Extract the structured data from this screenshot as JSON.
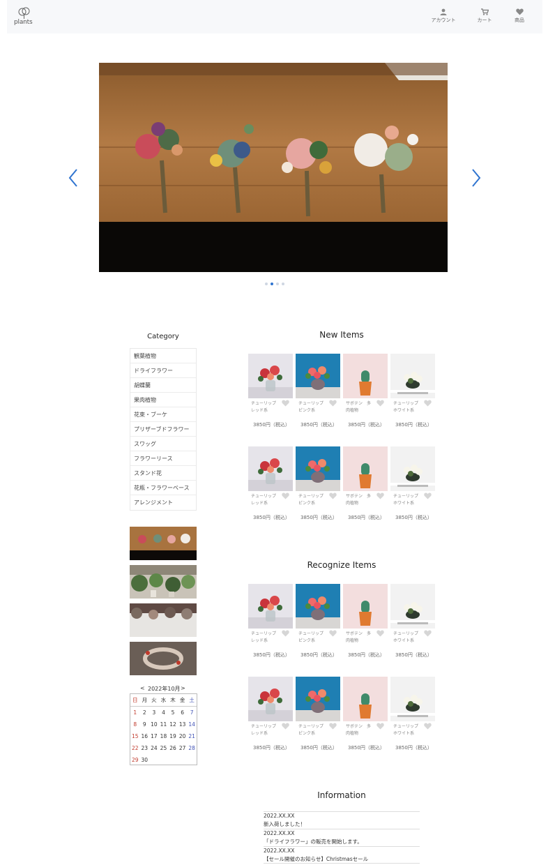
{
  "header": {
    "logo_text": "plants",
    "nav": [
      {
        "label": "アカウント",
        "icon": "user-icon"
      },
      {
        "label": "カート",
        "icon": "cart-icon"
      },
      {
        "label": "商品",
        "icon": "heart-icon"
      }
    ]
  },
  "hero": {
    "slides_count": 4,
    "active_slide": 2
  },
  "sidebar": {
    "category_title": "Category",
    "categories": [
      "観葉植物",
      "ドライフラワー",
      "胡蝶蘭",
      "果肉植物",
      "花束・ブーケ",
      "プリザーブドフラワー",
      "スワッグ",
      "フラワーリース",
      "スタンド花",
      "花瓶・フラワーベース",
      "アレンジメント"
    ],
    "banners": [
      "flower-bouquets-banner",
      "potted-plants-banner",
      "dried-flowers-banner",
      "wreath-banner"
    ]
  },
  "calendar": {
    "month_label": "2022年10月",
    "prev": "<",
    "next": ">",
    "weekdays": [
      "日",
      "月",
      "火",
      "水",
      "木",
      "金",
      "土"
    ],
    "weeks": [
      [
        "1",
        "2",
        "3",
        "4",
        "5",
        "6",
        "7"
      ],
      [
        "8",
        "9",
        "10",
        "11",
        "12",
        "13",
        "14"
      ],
      [
        "15",
        "16",
        "17",
        "18",
        "19",
        "20",
        "21"
      ],
      [
        "22",
        "23",
        "24",
        "25",
        "26",
        "27",
        "28"
      ],
      [
        "29",
        "30",
        "",
        "",
        "",
        "",
        ""
      ]
    ]
  },
  "new_items": {
    "title": "New Items",
    "rows": [
      [
        {
          "name": "チューリップ\nレッド系",
          "price": "3850円（税込）"
        },
        {
          "name": "チューリップ\nピンク系",
          "price": "3850円（税込）"
        },
        {
          "name": "サボテン　多\n肉植物",
          "price": "3850円（税込）"
        },
        {
          "name": "チューリップ\nホワイト系",
          "price": "3850円（税込）"
        }
      ],
      [
        {
          "name": "チューリップ\nレッド系",
          "price": "3850円（税込）"
        },
        {
          "name": "チューリップ\nピンク系",
          "price": "3850円（税込）"
        },
        {
          "name": "サボテン　多\n肉植物",
          "price": "3850円（税込）"
        },
        {
          "name": "チューリップ\nホワイト系",
          "price": "3850円（税込）"
        }
      ]
    ]
  },
  "recognize_items": {
    "title": "Recognize Items",
    "rows": [
      [
        {
          "name": "チューリップ\nレッド系",
          "price": "3850円（税込）"
        },
        {
          "name": "チューリップ\nピンク系",
          "price": "3850円（税込）"
        },
        {
          "name": "サボテン　多\n肉植物",
          "price": "3850円（税込）"
        },
        {
          "name": "チューリップ\nホワイト系",
          "price": "3850円（税込）"
        }
      ],
      [
        {
          "name": "チューリップ\nレッド系",
          "price": "3850円（税込）"
        },
        {
          "name": "チューリップ\nピンク系",
          "price": "3850円（税込）"
        },
        {
          "name": "サボテン　多\n肉植物",
          "price": "3850円（税込）"
        },
        {
          "name": "チューリップ\nホワイト系",
          "price": "3850円（税込）"
        }
      ]
    ]
  },
  "information": {
    "title": "Information",
    "items": [
      {
        "date": "2022.XX.XX",
        "text": "新入荷しました！"
      },
      {
        "date": "2022.XX.XX",
        "text": "「ドライフラワー」の販売を開始します。"
      },
      {
        "date": "2022.XX.XX",
        "text": "【セール開催のお知らせ】Christmasセール"
      }
    ]
  },
  "colors": {
    "accent": "#2f74d0",
    "header_bg": "#f7f8fa",
    "sunday": "#c0392b",
    "saturday": "#3f51b5"
  }
}
